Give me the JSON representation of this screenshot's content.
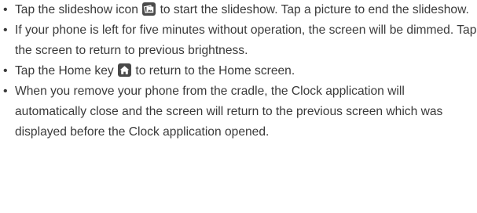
{
  "bullet_items": [
    {
      "before": "Tap the slideshow icon",
      "icon": "slideshow-icon",
      "after": "to start the slideshow. Tap a picture to end the slideshow."
    },
    {
      "text": "If your phone is left for five minutes without operation, the screen will be dimmed. Tap the screen to return to previous brightness."
    },
    {
      "before": "Tap the Home key",
      "icon": "home-icon",
      "after": "to return to the Home screen."
    },
    {
      "text": "When you remove your phone from the cradle, the Clock application will automatically close and the screen will return to the previous screen which was displayed before the Clock application opened."
    }
  ],
  "bullet_char": "•"
}
